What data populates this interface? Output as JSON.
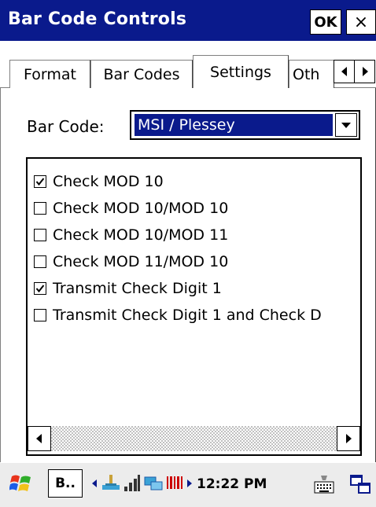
{
  "window": {
    "title": "Bar Code Controls",
    "ok_label": "OK",
    "close_label": "×"
  },
  "tabs": [
    {
      "label": "Format"
    },
    {
      "label": "Bar Codes"
    },
    {
      "label": "Settings"
    },
    {
      "label": "Oth"
    }
  ],
  "active_tab": "Settings",
  "barcode": {
    "label": "Bar Code:",
    "selected": "MSI / Plessey"
  },
  "options": [
    {
      "label": "Check MOD 10",
      "checked": true
    },
    {
      "label": "Check MOD 10/MOD 10",
      "checked": false
    },
    {
      "label": "Check MOD 10/MOD 11",
      "checked": false
    },
    {
      "label": "Check MOD 11/MOD 10",
      "checked": false
    },
    {
      "label": "Transmit Check Digit 1",
      "checked": true
    },
    {
      "label": "Transmit Check Digit 1 and Check D",
      "checked": false
    }
  ],
  "taskbar": {
    "task_label": "B..",
    "time": "12:22 PM"
  },
  "colors": {
    "titlebar": "#0a1a8c",
    "selection": "#0a1a8c"
  }
}
